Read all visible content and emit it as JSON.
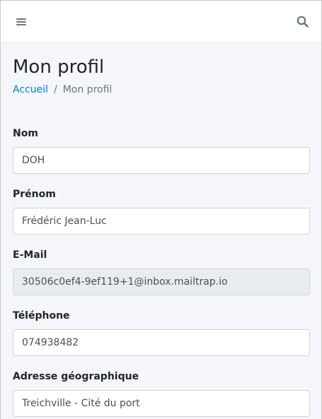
{
  "header": {
    "menu_icon": "hamburger-icon",
    "search_icon": "search-icon"
  },
  "page": {
    "title": "Mon profil"
  },
  "breadcrumb": {
    "home": "Accueil",
    "separator": "/",
    "current": "Mon profil"
  },
  "form": {
    "nom": {
      "label": "Nom",
      "value": "DOH"
    },
    "prenom": {
      "label": "Prénom",
      "value": "Frédéric Jean-Luc"
    },
    "email": {
      "label": "E-Mail",
      "value": "30506c0ef4-9ef119+1@inbox.mailtrap.io",
      "readonly": true
    },
    "telephone": {
      "label": "Téléphone",
      "value": "074938482"
    },
    "adresse": {
      "label": "Adresse géographique",
      "value": "Treichville - Cité du port"
    }
  },
  "colors": {
    "link": "#007bff",
    "background": "#f4f6f9",
    "readonly_field": "#e9ecef"
  }
}
